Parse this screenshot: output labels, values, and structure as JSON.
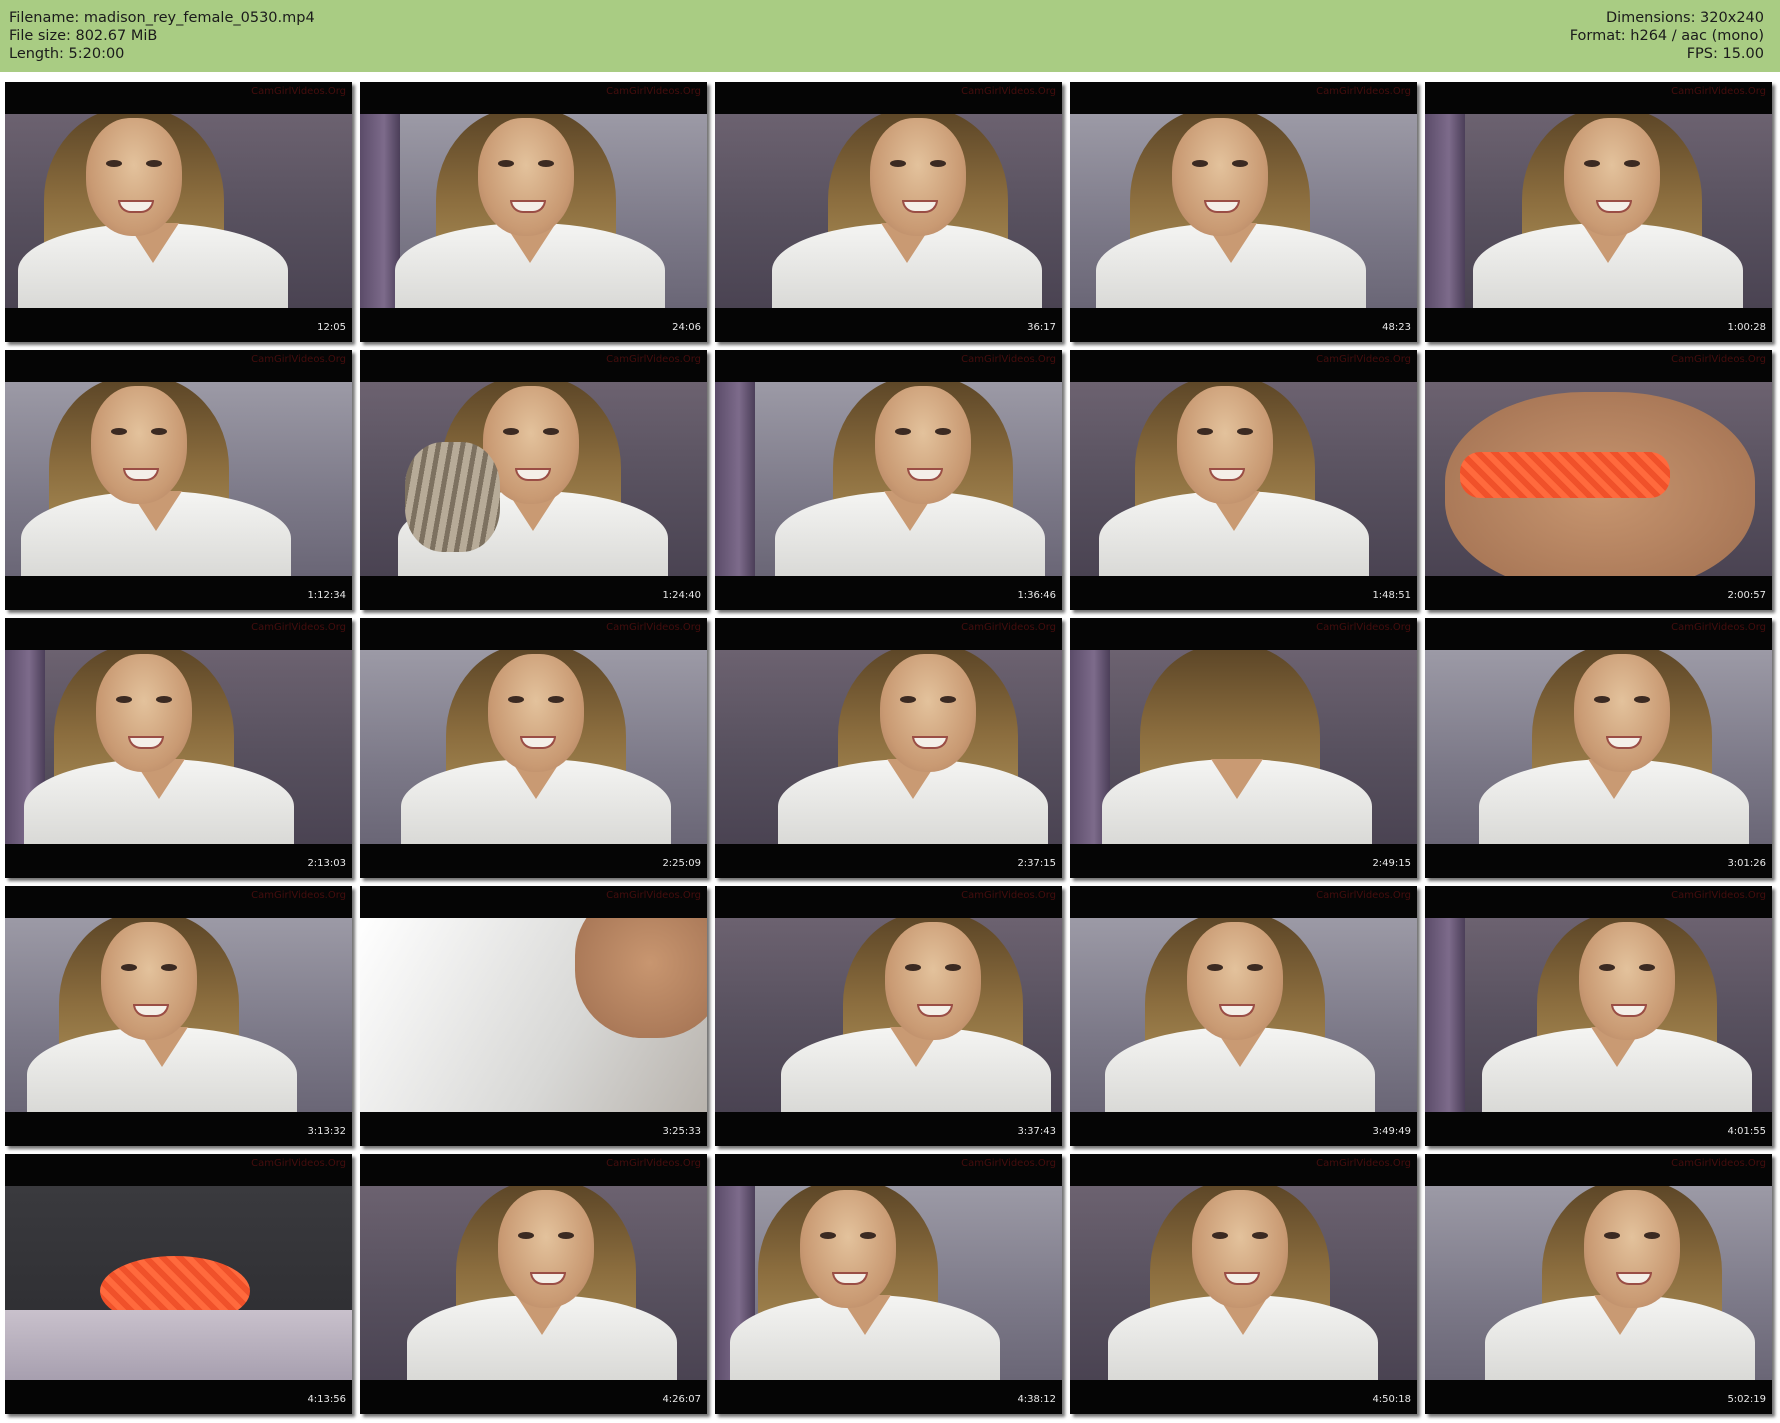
{
  "header": {
    "filename": "Filename: madison_rey_female_0530.mp4",
    "filesize": "File size: 802.67 MiB",
    "length": "Length: 5:20:00",
    "dimensions": "Dimensions: 320x240",
    "format": "Format: h264 / aac (mono)",
    "fps": "FPS: 15.00"
  },
  "watermark": "CamGirlVideos.Org",
  "thumbnails": [
    {
      "time": "12:05"
    },
    {
      "time": "24:06"
    },
    {
      "time": "36:17"
    },
    {
      "time": "48:23"
    },
    {
      "time": "1:00:28"
    },
    {
      "time": "1:12:34"
    },
    {
      "time": "1:24:40"
    },
    {
      "time": "1:36:46"
    },
    {
      "time": "1:48:51"
    },
    {
      "time": "2:00:57"
    },
    {
      "time": "2:13:03"
    },
    {
      "time": "2:25:09"
    },
    {
      "time": "2:37:15"
    },
    {
      "time": "2:49:15"
    },
    {
      "time": "3:01:26"
    },
    {
      "time": "3:13:32"
    },
    {
      "time": "3:25:33"
    },
    {
      "time": "3:37:43"
    },
    {
      "time": "3:49:49"
    },
    {
      "time": "4:01:55"
    },
    {
      "time": "4:13:56"
    },
    {
      "time": "4:26:07"
    },
    {
      "time": "4:38:12"
    },
    {
      "time": "4:50:18"
    },
    {
      "time": "5:02:19"
    }
  ]
}
